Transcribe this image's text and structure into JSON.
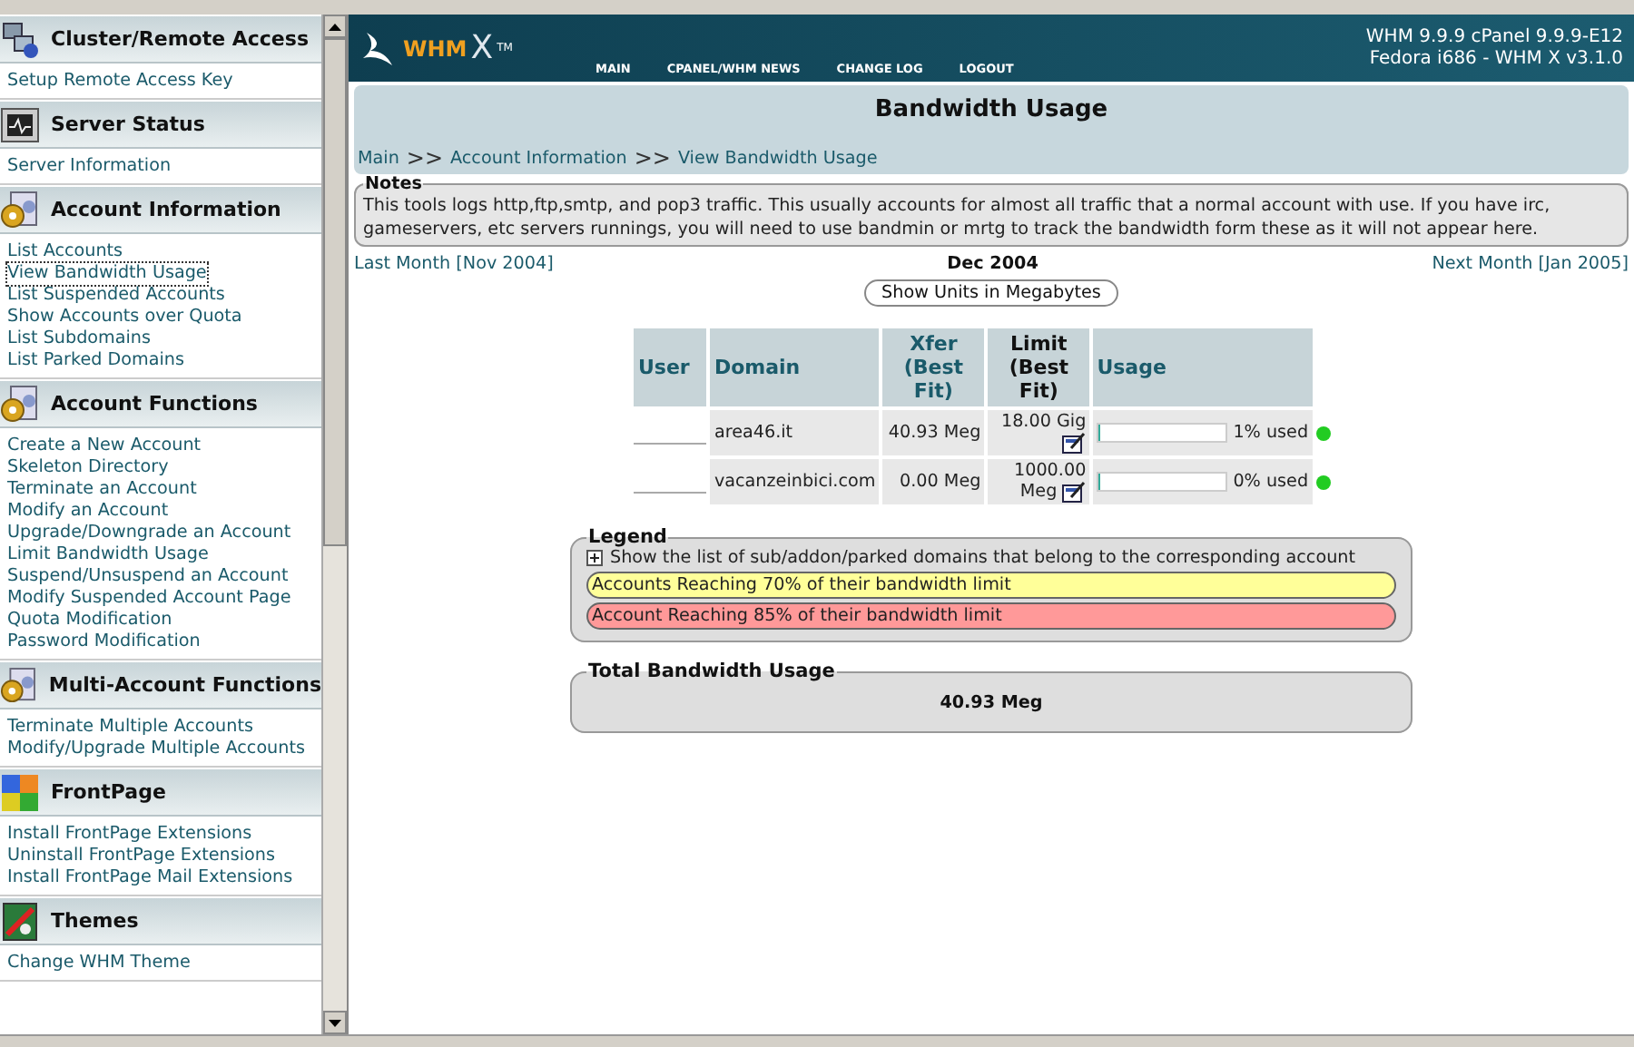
{
  "sidebar": {
    "sections": [
      {
        "title": "Cluster/Remote Access",
        "items": [
          {
            "label": "Setup Remote Access Key",
            "selected": false
          }
        ]
      },
      {
        "title": "Server Status",
        "items": [
          {
            "label": "Server Information",
            "selected": false
          }
        ]
      },
      {
        "title": "Account Information",
        "items": [
          {
            "label": "List Accounts",
            "selected": false
          },
          {
            "label": "View Bandwidth Usage",
            "selected": true
          },
          {
            "label": "List Suspended Accounts",
            "selected": false
          },
          {
            "label": "Show Accounts over Quota",
            "selected": false
          },
          {
            "label": "List Subdomains",
            "selected": false
          },
          {
            "label": "List Parked Domains",
            "selected": false
          }
        ]
      },
      {
        "title": "Account Functions",
        "items": [
          {
            "label": "Create a New Account",
            "selected": false
          },
          {
            "label": "Skeleton Directory",
            "selected": false
          },
          {
            "label": "Terminate an Account",
            "selected": false
          },
          {
            "label": "Modify an Account",
            "selected": false
          },
          {
            "label": "Upgrade/Downgrade an Account",
            "selected": false
          },
          {
            "label": "Limit Bandwidth Usage",
            "selected": false
          },
          {
            "label": "Suspend/Unsuspend an Account",
            "selected": false
          },
          {
            "label": "Modify Suspended Account Page",
            "selected": false
          },
          {
            "label": "Quota Modification",
            "selected": false
          },
          {
            "label": "Password Modification",
            "selected": false
          }
        ]
      },
      {
        "title": "Multi-Account Functions",
        "items": [
          {
            "label": "Terminate Multiple Accounts",
            "selected": false
          },
          {
            "label": "Modify/Upgrade Multiple Accounts",
            "selected": false
          }
        ]
      },
      {
        "title": "FrontPage",
        "items": [
          {
            "label": "Install FrontPage Extensions",
            "selected": false
          },
          {
            "label": "Uninstall FrontPage Extensions",
            "selected": false
          },
          {
            "label": "Install FrontPage Mail Extensions",
            "selected": false
          }
        ]
      },
      {
        "title": "Themes",
        "items": [
          {
            "label": "Change WHM Theme",
            "selected": false
          }
        ]
      }
    ]
  },
  "header": {
    "logo": "WHM",
    "logo_x": "X",
    "logo_tm": "TM",
    "nav": [
      "MAIN",
      "CPANEL/WHM NEWS",
      "CHANGE LOG",
      "LOGOUT"
    ],
    "version_lines": [
      "WHM 9.9.9 cPanel 9.9.9-E12",
      "Fedora i686 - WHM X v3.1.0"
    ]
  },
  "page_title": "Bandwidth Usage",
  "breadcrumb": [
    {
      "label": "Main"
    },
    {
      "label": ">>",
      "kind": "sep"
    },
    {
      "label": "Account Information"
    },
    {
      "label": ">>",
      "kind": "sep"
    },
    {
      "label": "View Bandwidth Usage"
    }
  ],
  "notes": {
    "title": "Notes",
    "text": "This tools logs http,ftp,smtp, and pop3 traffic. This usually accounts for almost all traffic that a normal account with use. If you have irc, gameservers, etc servers runnings, you will need to use bandmin or mrtg to track the bandwidth form these as it will not appear here."
  },
  "month_nav": {
    "previous": "Last Month [Nov 2004]",
    "current": "Dec 2004",
    "next": "Next Month [Jan 2005]"
  },
  "units_button": "Show Units in Megabytes",
  "table": {
    "columns": [
      {
        "label": "User"
      },
      {
        "label": "Domain"
      },
      {
        "label": "Xfer (Best Fit)"
      },
      {
        "label": "Limit (Best Fit)"
      },
      {
        "label": "Usage"
      }
    ],
    "rows": [
      {
        "domain": "area46.it",
        "xfer": "40.93 Meg",
        "limit": "18.00 Gig",
        "level": 0.01,
        "reading": "1% used",
        "color": "#22cc22"
      },
      {
        "domain": "vacanzeinbici.com",
        "xfer": "0.00 Meg",
        "limit": "1000.00 Meg",
        "level": 0.0,
        "reading": "0% used",
        "color": "#22cc22"
      }
    ]
  },
  "legend": {
    "title": "Legend",
    "items": [
      {
        "kind": "expand",
        "label": "Show the list of sub/addon/parked domains that belong to the corresponding account"
      },
      {
        "kind": "swatch",
        "label": "Accounts Reaching 70% of their bandwidth limit",
        "color": "#ffff99"
      },
      {
        "kind": "swatch",
        "label": "Account Reaching 85% of their bandwidth limit",
        "color": "#ff9999"
      }
    ]
  },
  "total": {
    "title": "Total Bandwidth Usage",
    "value": "40.93 Meg"
  }
}
